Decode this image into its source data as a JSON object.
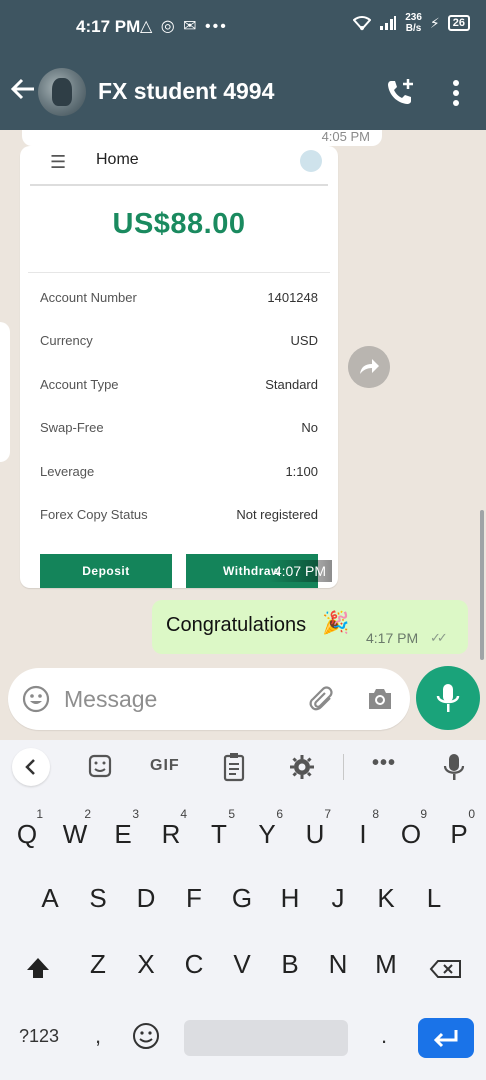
{
  "status_bar": {
    "time": "4:17 PM",
    "net_speed_value": "236",
    "net_speed_unit": "B/s",
    "battery": "26"
  },
  "chat_header": {
    "contact_name": "FX student 4994"
  },
  "messages": {
    "prev_time": "4:05 PM",
    "image_message": {
      "screen_title": "Home",
      "balance": "US$88.00",
      "rows": [
        {
          "label": "Account Number",
          "value": "1401248"
        },
        {
          "label": "Currency",
          "value": "USD"
        },
        {
          "label": "Account Type",
          "value": "Standard"
        },
        {
          "label": "Swap-Free",
          "value": "No"
        },
        {
          "label": "Leverage",
          "value": "1:100"
        },
        {
          "label": "Forex Copy Status",
          "value": "Not registered"
        }
      ],
      "deposit_label": "Deposit",
      "withdraw_label": "Withdraw",
      "time": "4:07 PM"
    },
    "outgoing": {
      "text": "Congratulations",
      "emoji": "🎉",
      "time": "4:17 PM"
    }
  },
  "composer": {
    "placeholder": "Message"
  },
  "keyboard": {
    "toolbar_gif": "GIF",
    "row1": [
      {
        "key": "Q",
        "hint": "1"
      },
      {
        "key": "W",
        "hint": "2"
      },
      {
        "key": "E",
        "hint": "3"
      },
      {
        "key": "R",
        "hint": "4"
      },
      {
        "key": "T",
        "hint": "5"
      },
      {
        "key": "Y",
        "hint": "6"
      },
      {
        "key": "U",
        "hint": "7"
      },
      {
        "key": "I",
        "hint": "8"
      },
      {
        "key": "O",
        "hint": "9"
      },
      {
        "key": "P",
        "hint": "0"
      }
    ],
    "row2": [
      "A",
      "S",
      "D",
      "F",
      "G",
      "H",
      "J",
      "K",
      "L"
    ],
    "row3": [
      "Z",
      "X",
      "C",
      "V",
      "B",
      "N",
      "M"
    ],
    "symbols_label": "?123",
    "comma": ",",
    "period": "."
  }
}
